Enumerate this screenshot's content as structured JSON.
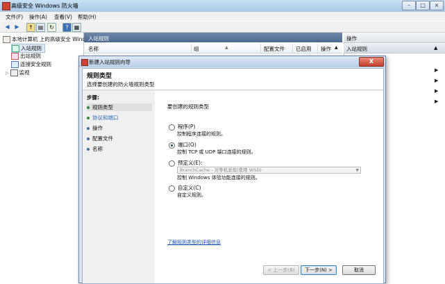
{
  "window": {
    "title": "高级安全 Windows 防火墙"
  },
  "menu": [
    "文件(F)",
    "操作(A)",
    "查看(V)",
    "帮助(H)"
  ],
  "tree": {
    "root": "本地计算机 上的高级安全 Windo",
    "items": [
      "入站规则",
      "出站规则",
      "连接安全规则",
      "监视"
    ]
  },
  "center": {
    "title": "入站规则",
    "columns": [
      "名称",
      "组",
      "配置文件",
      "已启用",
      "操作"
    ]
  },
  "actions": {
    "title": "操作",
    "subtitle": "入站规则"
  },
  "dialog": {
    "title": "新建入站规则向导",
    "close": "X",
    "heading": "规则类型",
    "subheading": "选择要创建的防火墙规则类型",
    "steps_title": "步骤:",
    "steps": [
      "规则类型",
      "协议和端口",
      "操作",
      "配置文件",
      "名称"
    ],
    "question": "要创建的规则类型",
    "options": [
      {
        "label": "程序(P)",
        "desc": "控制程序连接的规则。",
        "selected": false
      },
      {
        "label": "端口(O)",
        "desc": "控制 TCP 或 UDP 端口连接的规则。",
        "selected": true
      },
      {
        "label": "预定义(E):",
        "desc": "控制 Windows 体验功能连接的规则。",
        "selected": false
      },
      {
        "label": "自定义(C)",
        "desc": "自定义规则。",
        "selected": false
      }
    ],
    "predefined_value": "BranchCache - 对等机发现(使用 WSD)",
    "link": "了解规则类型的详细信息",
    "buttons": {
      "back": "< 上一步(B)",
      "next": "下一步(N) >",
      "cancel": "取消"
    }
  }
}
